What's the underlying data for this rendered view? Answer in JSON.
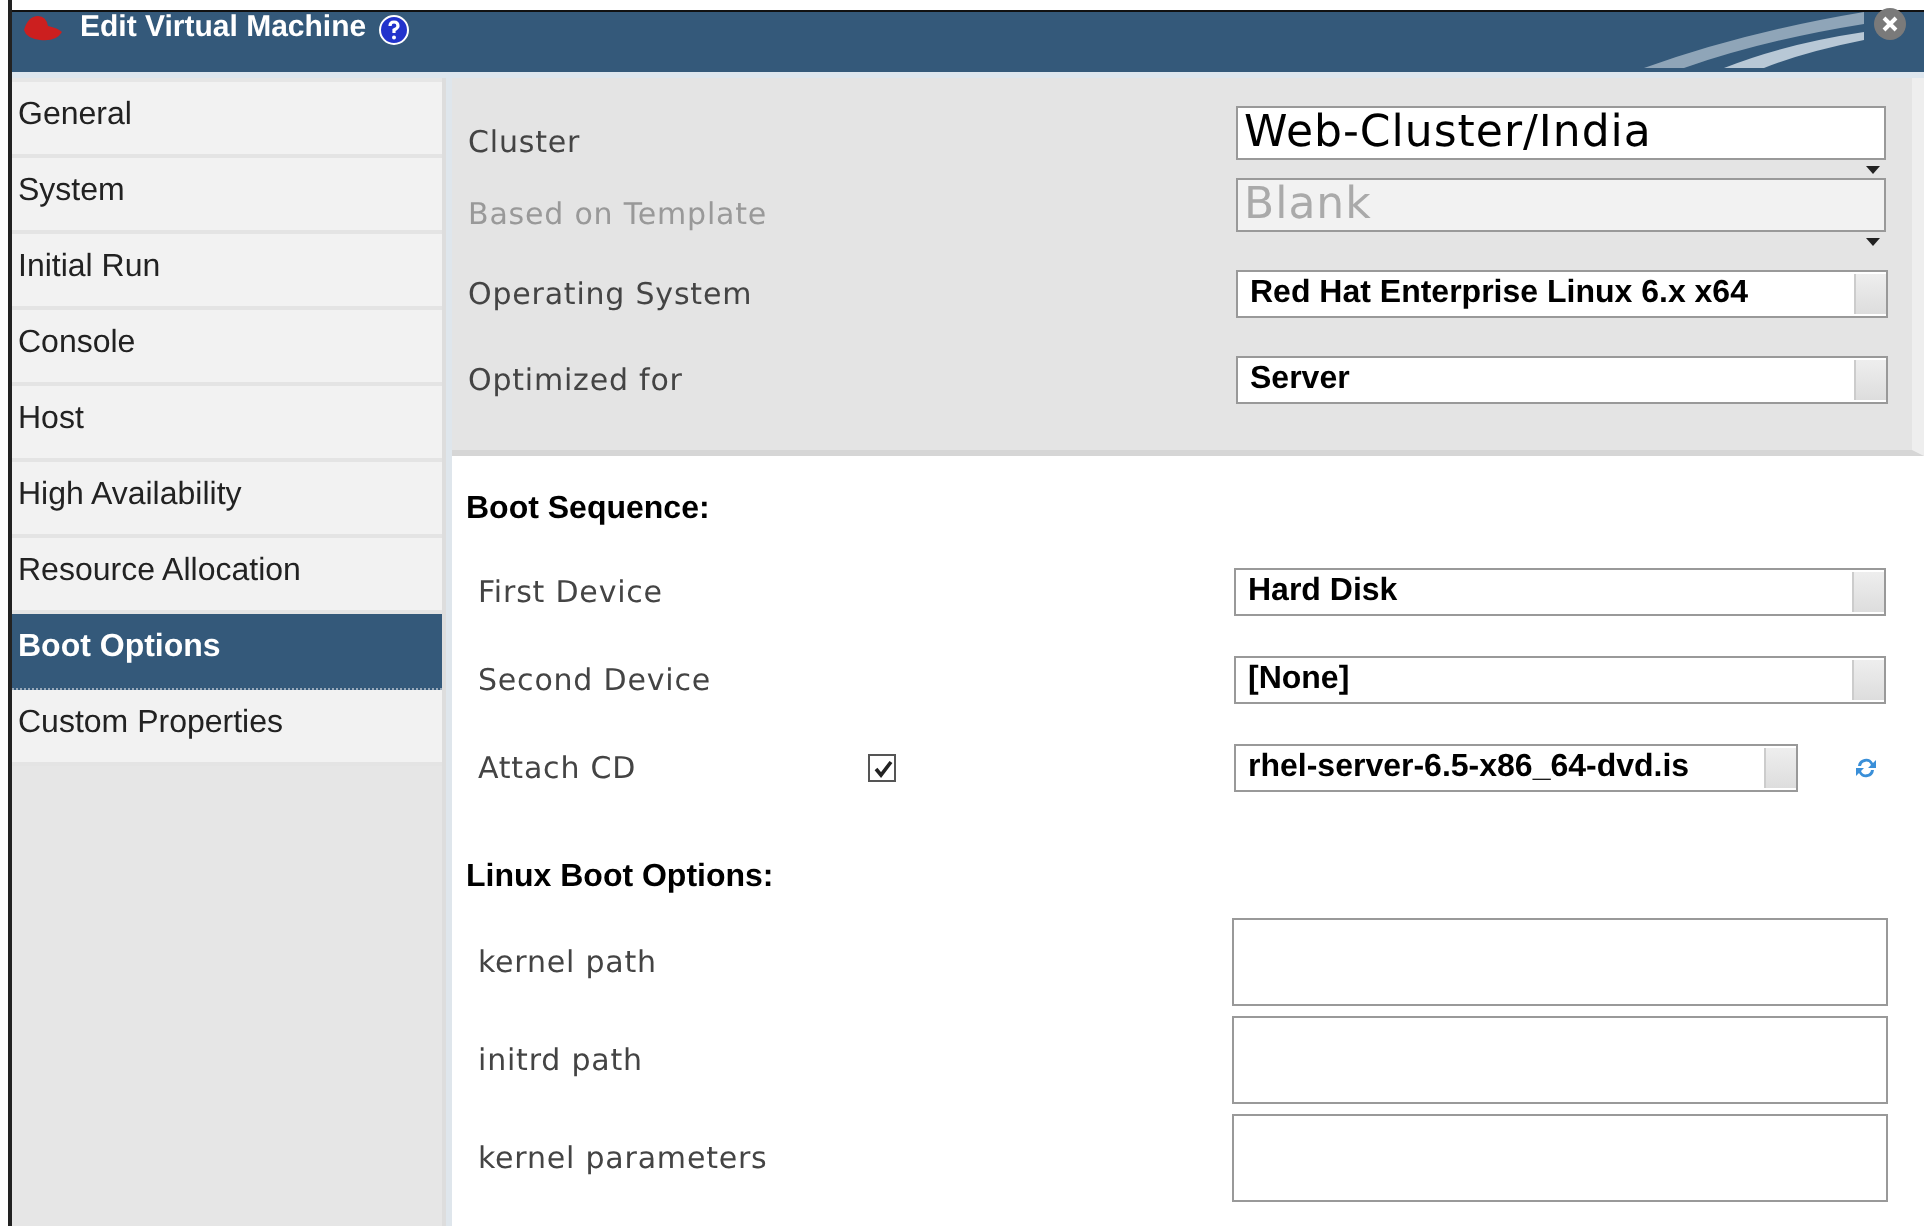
{
  "window": {
    "title": "Edit Virtual Machine"
  },
  "sidebar": {
    "items": [
      {
        "label": "General",
        "selected": false
      },
      {
        "label": "System",
        "selected": false
      },
      {
        "label": "Initial Run",
        "selected": false
      },
      {
        "label": "Console",
        "selected": false
      },
      {
        "label": "Host",
        "selected": false
      },
      {
        "label": "High Availability",
        "selected": false
      },
      {
        "label": "Resource Allocation",
        "selected": false
      },
      {
        "label": "Boot Options",
        "selected": true
      },
      {
        "label": "Custom Properties",
        "selected": false
      }
    ]
  },
  "general": [
    {
      "label": "Cluster",
      "value": "Web-Cluster/India",
      "kind": "combo",
      "disabled": false
    },
    {
      "label": "Based on Template",
      "value": "Blank",
      "kind": "combo",
      "disabled": true
    },
    {
      "label": "Operating System",
      "value": "Red Hat Enterprise Linux 6.x x64",
      "kind": "select",
      "disabled": false
    },
    {
      "label": "Optimized for",
      "value": "Server",
      "kind": "select",
      "disabled": false
    }
  ],
  "boot_sequence": {
    "heading": "Boot Sequence:",
    "rows": [
      {
        "label": "First Device",
        "value": "Hard Disk",
        "kind": "select"
      },
      {
        "label": "Second Device",
        "value": "[None]",
        "kind": "select"
      },
      {
        "label": "Attach CD",
        "value": "rhel-server-6.5-x86_64-dvd.is",
        "kind": "cd",
        "checked": true
      }
    ]
  },
  "linux_boot_options": {
    "heading": "Linux Boot Options:",
    "fields": [
      {
        "label": "kernel path"
      },
      {
        "label": "initrd path"
      },
      {
        "label": "kernel parameters"
      }
    ]
  }
}
